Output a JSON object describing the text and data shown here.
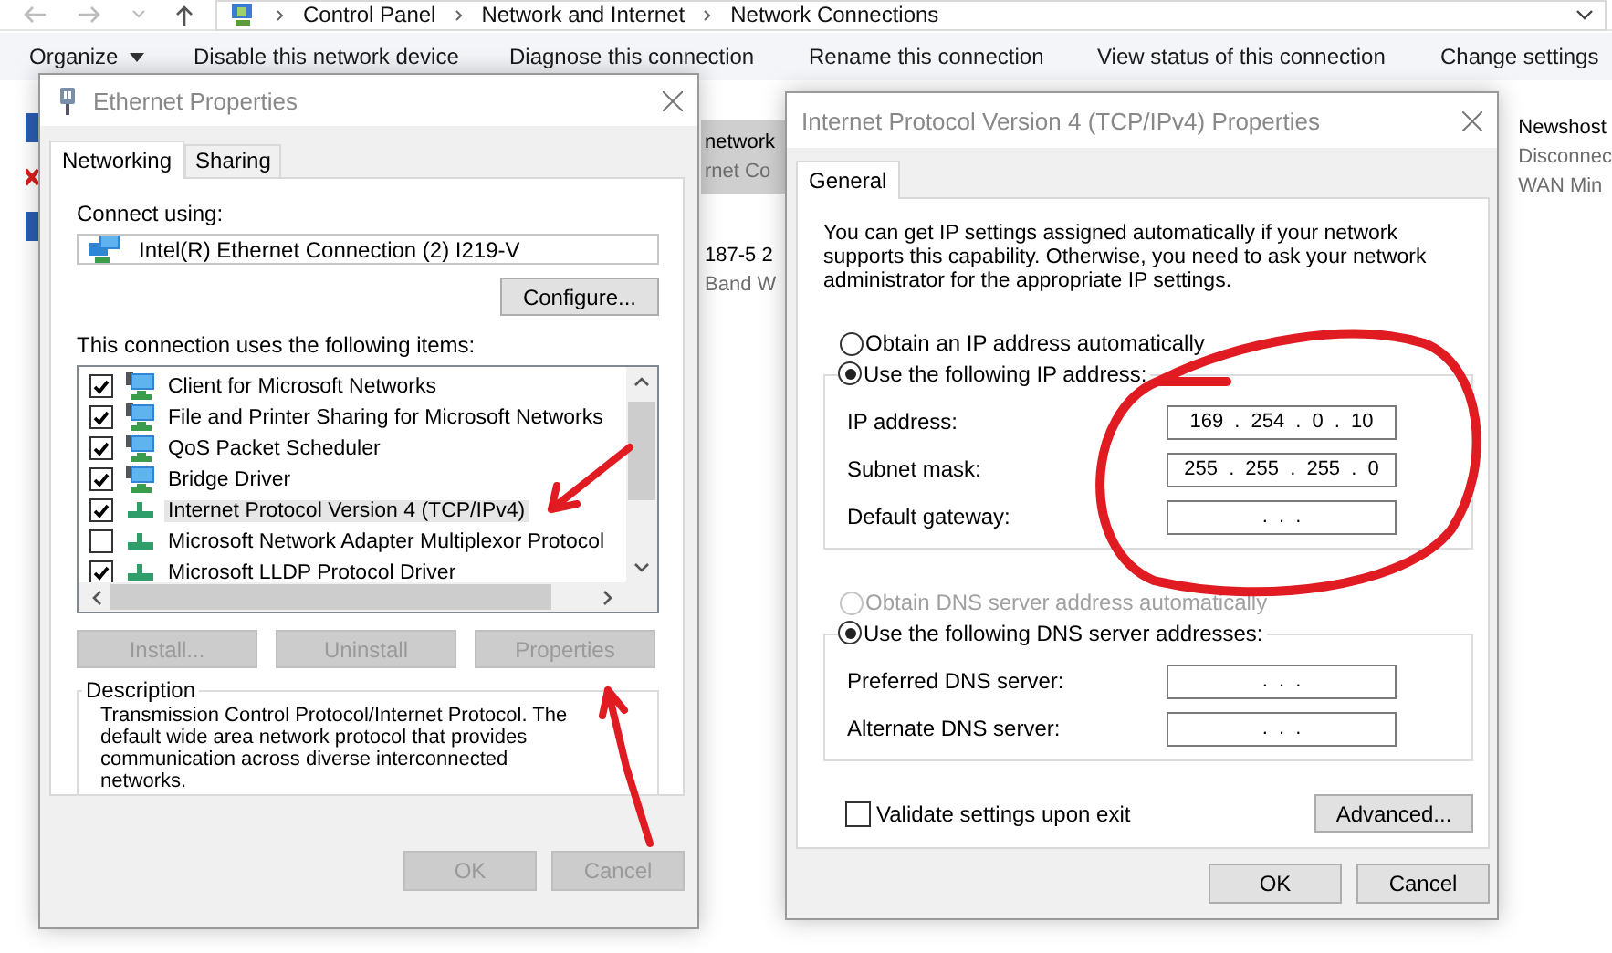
{
  "explorer": {
    "breadcrumb": [
      "Control Panel",
      "Network and Internet",
      "Network Connections"
    ],
    "toolbar": [
      {
        "label": "Organize",
        "dropdown": true
      },
      {
        "label": "Disable this network device",
        "dropdown": false
      },
      {
        "label": "Diagnose this connection",
        "dropdown": false
      },
      {
        "label": "Rename this connection",
        "dropdown": false
      },
      {
        "label": "View status of this connection",
        "dropdown": false
      },
      {
        "label": "Change settings",
        "dropdown": false
      }
    ],
    "middle_items": [
      {
        "lines": [
          "network",
          "rnet Co"
        ],
        "selected": true
      },
      {
        "lines": [
          "187-5 2",
          "Band W"
        ],
        "selected": false
      }
    ],
    "right_items": [
      {
        "lines": [
          "Newshost",
          "Disconnec",
          "WAN Min"
        ],
        "selected": false
      }
    ]
  },
  "ethernet_dialog": {
    "title": "Ethernet Properties",
    "tabs": [
      {
        "label": "Networking",
        "selected": true
      },
      {
        "label": "Sharing",
        "selected": false
      }
    ],
    "connect_label": "Connect using:",
    "adapter": "Intel(R) Ethernet Connection (2) I219-V",
    "configure_button": {
      "label": "Configure...",
      "disabled": false
    },
    "items_label": "This connection uses the following items:",
    "items": [
      {
        "label": "Client for Microsoft Networks",
        "kind": "service",
        "checked": true,
        "selected": false
      },
      {
        "label": "File and Printer Sharing for Microsoft Networks",
        "kind": "service",
        "checked": true,
        "selected": false
      },
      {
        "label": "QoS Packet Scheduler",
        "kind": "service",
        "checked": true,
        "selected": false
      },
      {
        "label": "Bridge Driver",
        "kind": "service",
        "checked": true,
        "selected": false
      },
      {
        "label": "Internet Protocol Version 4 (TCP/IPv4)",
        "kind": "protocol",
        "checked": true,
        "selected": true
      },
      {
        "label": "Microsoft Network Adapter Multiplexor Protocol",
        "kind": "protocol",
        "checked": false,
        "selected": false
      },
      {
        "label": "Microsoft LLDP Protocol Driver",
        "kind": "protocol",
        "checked": true,
        "selected": false
      }
    ],
    "item_buttons": [
      {
        "label": "Install...",
        "disabled": true
      },
      {
        "label": "Uninstall",
        "disabled": true
      },
      {
        "label": "Properties",
        "disabled": true
      }
    ],
    "description_label": "Description",
    "description": "Transmission Control Protocol/Internet Protocol. The default wide area network protocol that provides communication across diverse interconnected networks.",
    "footer_buttons": [
      {
        "label": "OK",
        "disabled": true
      },
      {
        "label": "Cancel",
        "disabled": true
      }
    ]
  },
  "ipv4_dialog": {
    "title": "Internet Protocol Version 4 (TCP/IPv4) Properties",
    "tabs": [
      {
        "label": "General",
        "selected": true
      }
    ],
    "intro": "You can get IP settings assigned automatically if your network supports this capability. Otherwise, you need to ask your network administrator for the appropriate IP settings.",
    "ip_options": [
      {
        "label": "Obtain an IP address automatically",
        "selected": false,
        "disabled": false
      },
      {
        "label": "Use the following IP address:",
        "selected": true,
        "disabled": false
      }
    ],
    "ip_fields": [
      {
        "label": "IP address:",
        "value": "169 . 254 . 0 . 10"
      },
      {
        "label": "Subnet mask:",
        "value": "255 . 255 . 255 . 0"
      },
      {
        "label": "Default gateway:",
        "value": ". . ."
      }
    ],
    "dns_options": [
      {
        "label": "Obtain DNS server address automatically",
        "selected": false,
        "disabled": true
      },
      {
        "label": "Use the following DNS server addresses:",
        "selected": true,
        "disabled": false
      }
    ],
    "dns_fields": [
      {
        "label": "Preferred DNS server:",
        "value": ". . ."
      },
      {
        "label": "Alternate DNS server:",
        "value": ". . ."
      }
    ],
    "validate": {
      "label": "Validate settings upon exit",
      "checked": false
    },
    "advanced_button": "Advanced...",
    "footer_buttons": [
      {
        "label": "OK",
        "disabled": false
      },
      {
        "label": "Cancel",
        "disabled": false
      }
    ]
  }
}
